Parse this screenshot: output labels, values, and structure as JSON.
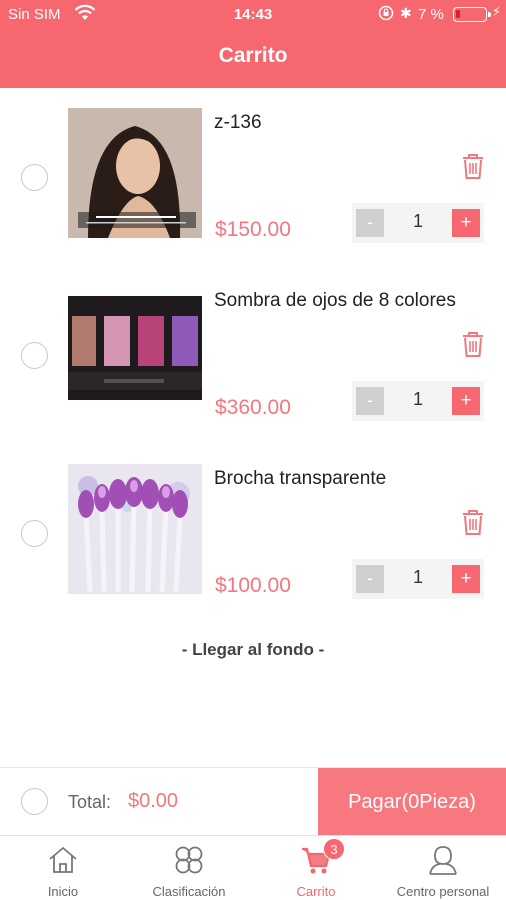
{
  "status_bar": {
    "carrier": "Sin SIM",
    "time": "14:43",
    "battery": "7 %"
  },
  "header": {
    "title": "Carrito"
  },
  "items": [
    {
      "name": "z-136",
      "price": "$150.00",
      "qty": "1",
      "image": "woman-portrait-photo"
    },
    {
      "name": "Sombra de ojos de 8 colores",
      "price": "$360.00",
      "qty": "1",
      "image": "eyeshadow-palette-photo"
    },
    {
      "name": "Brocha transparente",
      "price": "$100.00",
      "qty": "1",
      "image": "makeup-brush-set-photo"
    }
  ],
  "stepper": {
    "minus": "-",
    "plus": "+"
  },
  "list_end": "- Llegar al fondo -",
  "checkout": {
    "total_label": "Total:",
    "total_value": "$0.00",
    "pay_label": "Pagar(0Pieza)"
  },
  "tabbar": {
    "tabs": [
      {
        "label": "Inicio",
        "icon": "home-icon"
      },
      {
        "label": "Clasificación",
        "icon": "category-icon"
      },
      {
        "label": "Carrito",
        "icon": "cart-icon",
        "badge": "3"
      },
      {
        "label": "Centro personal",
        "icon": "user-icon"
      }
    ]
  },
  "colors": {
    "accent": "#f7676f",
    "price": "#f2777e"
  }
}
